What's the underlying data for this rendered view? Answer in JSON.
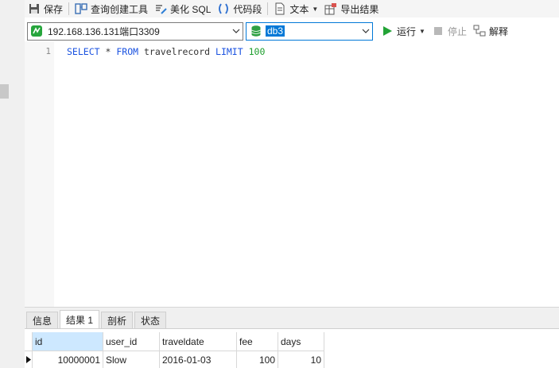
{
  "toolbar": {
    "save_label": "保存",
    "query_builder_label": "查询创建工具",
    "beautify_sql_label": "美化 SQL",
    "code_snippet_label": "代码段",
    "text_label": "文本",
    "export_label": "导出结果"
  },
  "connection": {
    "selected": "192.168.136.131端口3309"
  },
  "database": {
    "selected": "db3"
  },
  "run": {
    "run_label": "运行",
    "stop_label": "停止",
    "explain_label": "解释"
  },
  "editor": {
    "line_number": "1",
    "sql": {
      "select": "SELECT",
      "star": "*",
      "from": "FROM",
      "table": "travelrecord",
      "limit": "LIMIT",
      "count": "100"
    }
  },
  "result_tabs": [
    "信息",
    "结果 1",
    "剖析",
    "状态"
  ],
  "active_tab_index": 1,
  "grid": {
    "columns": [
      "id",
      "user_id",
      "traveldate",
      "fee",
      "days"
    ],
    "rows": [
      [
        "10000001",
        "Slow",
        "2016-01-03",
        "100",
        "10"
      ]
    ]
  },
  "colors": {
    "accent": "#0078d7",
    "keyword": "#1a52e0",
    "number": "#1c9e2c",
    "run_green": "#22a336",
    "header_selected": "#cde8ff"
  }
}
